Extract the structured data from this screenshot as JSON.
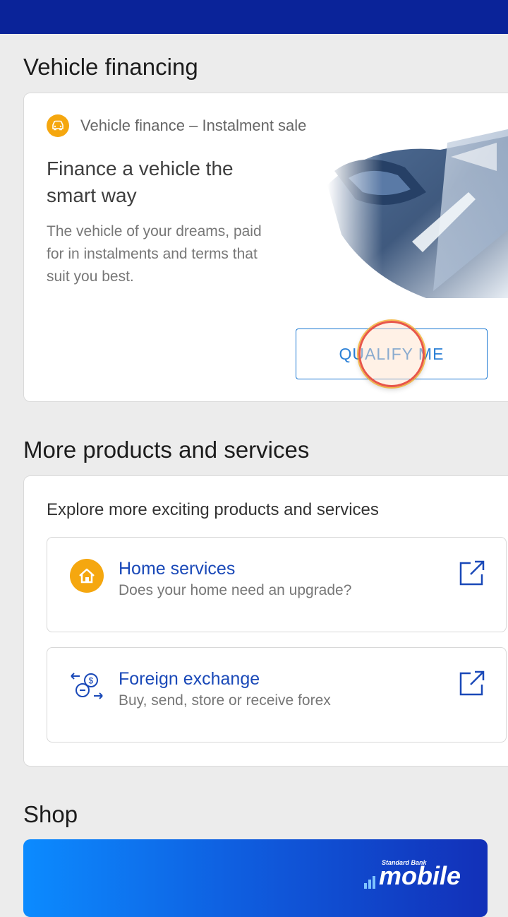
{
  "sections": {
    "vehicle_title": "Vehicle financing",
    "more_title": "More products and services",
    "shop_title": "Shop"
  },
  "vehicle_card": {
    "subtitle": "Vehicle finance – Instalment sale",
    "headline": "Finance a vehicle the smart way",
    "description": "The vehicle of your dreams, paid for in instalments and terms that suit you best.",
    "cta_label": "QUALIFY ME"
  },
  "more_card": {
    "intro": "Explore more exciting products and services",
    "items": [
      {
        "title": "Home services",
        "description": "Does your home need an upgrade?",
        "icon": "home-icon"
      },
      {
        "title": "Foreign exchange",
        "description": "Buy, send, store or receive forex",
        "icon": "forex-exchange-icon"
      }
    ]
  },
  "shop": {
    "logo_small": "Standard Bank",
    "logo_big": "mobile"
  },
  "colors": {
    "topbar": "#0a2399",
    "accent_blue": "#1a49b8",
    "orange": "#f5a70f",
    "button_border": "#1a77d2"
  }
}
